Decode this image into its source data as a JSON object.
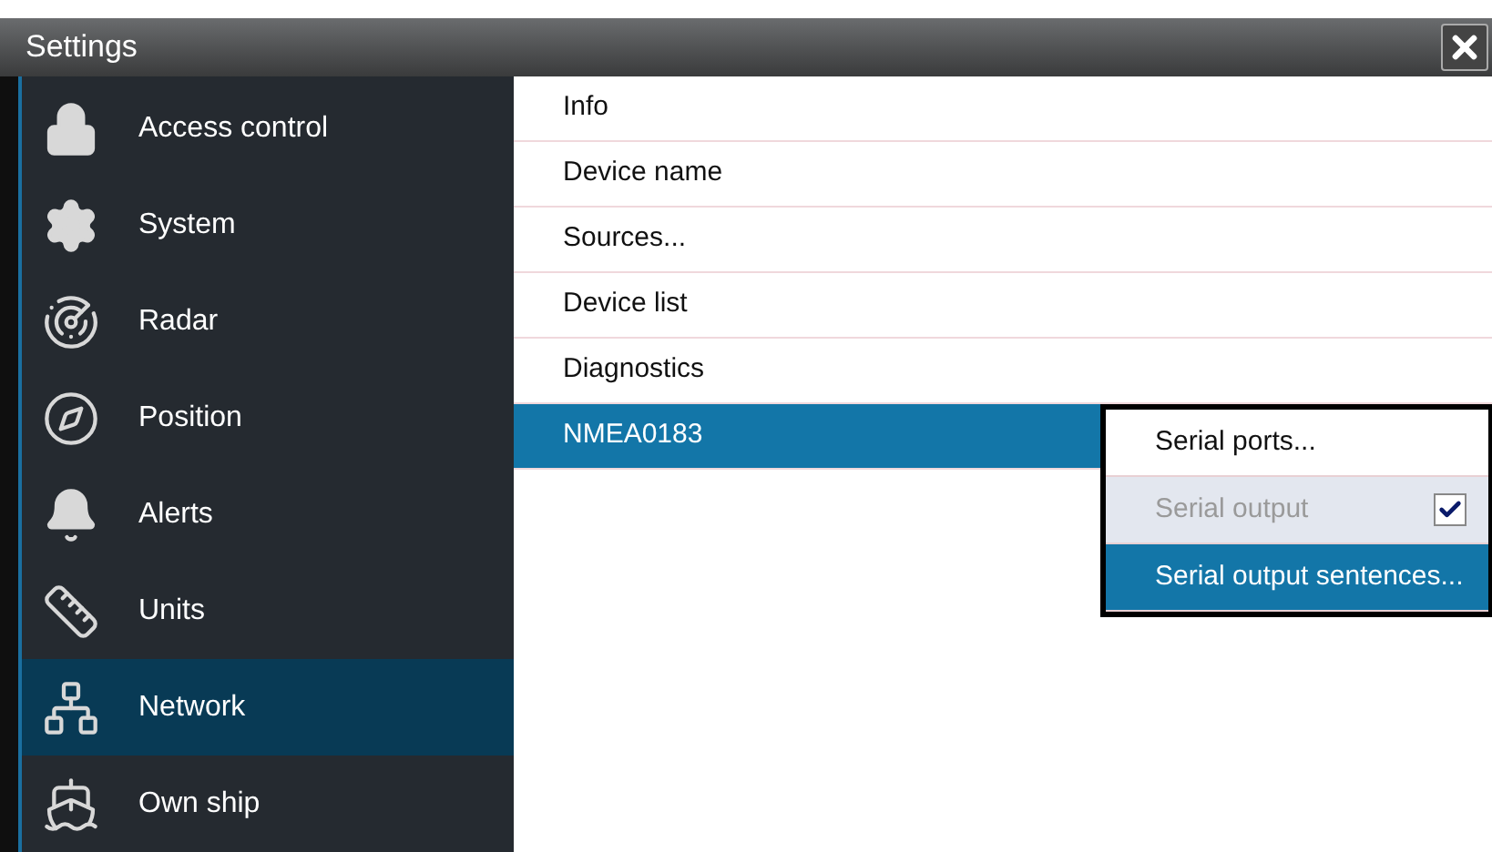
{
  "window": {
    "title": "Settings"
  },
  "sidebar": {
    "items": [
      {
        "label": "Access control",
        "selected": false
      },
      {
        "label": "System",
        "selected": false
      },
      {
        "label": "Radar",
        "selected": false
      },
      {
        "label": "Position",
        "selected": false
      },
      {
        "label": "Alerts",
        "selected": false
      },
      {
        "label": "Units",
        "selected": false
      },
      {
        "label": "Network",
        "selected": true
      },
      {
        "label": "Own ship",
        "selected": false
      }
    ]
  },
  "list": {
    "items": [
      {
        "label": "Info",
        "selected": false
      },
      {
        "label": "Device name",
        "selected": false
      },
      {
        "label": "Sources...",
        "selected": false
      },
      {
        "label": "Device list",
        "selected": false
      },
      {
        "label": "Diagnostics",
        "selected": false
      },
      {
        "label": "NMEA0183",
        "selected": true
      }
    ]
  },
  "submenu": {
    "items": [
      {
        "label": "Serial ports...",
        "kind": "action",
        "disabled": false,
        "selected": false
      },
      {
        "label": "Serial output",
        "kind": "checkbox",
        "checked": true,
        "disabled": true,
        "selected": false
      },
      {
        "label": "Serial output sentences...",
        "kind": "action",
        "disabled": false,
        "selected": true
      }
    ]
  }
}
